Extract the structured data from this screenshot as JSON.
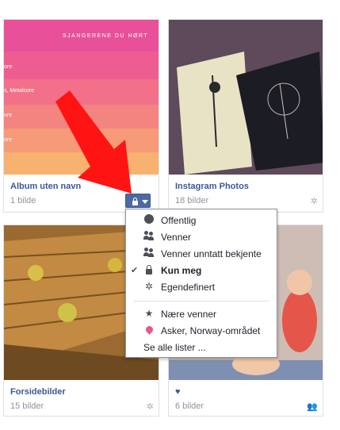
{
  "albums": [
    {
      "title": "Album uten navn",
      "count": "1 bilde",
      "thumb_text": {
        "heading": "SJANGERENE DU HØRT",
        "line1": "ore",
        "line2": "s, Metalcore",
        "line3": "ore",
        "line4": "ore"
      }
    },
    {
      "title": "Instagram Photos",
      "count": "18 bilder"
    },
    {
      "title": "Forsidebilder",
      "count": "15 bilder"
    },
    {
      "title": "♥",
      "count": "6 bilder"
    }
  ],
  "privacy_menu": {
    "items": [
      {
        "label": "Offentlig",
        "icon": "globe-icon"
      },
      {
        "label": "Venner",
        "icon": "friends-icon"
      },
      {
        "label": "Venner unntatt bekjente",
        "icon": "friends-except-icon"
      },
      {
        "label": "Kun meg",
        "icon": "lock-icon",
        "selected": true
      },
      {
        "label": "Egendefinert",
        "icon": "gear-icon"
      },
      {
        "label": "Nære venner",
        "icon": "star-icon"
      },
      {
        "label": "Asker, Norway-området",
        "icon": "location-icon"
      },
      {
        "label": "Se alle lister ...",
        "icon": ""
      }
    ]
  },
  "colors": {
    "link": "#3b5998",
    "muted": "#90949c",
    "arrow": "#ff0000",
    "privacy_button": "#4e69a2"
  }
}
